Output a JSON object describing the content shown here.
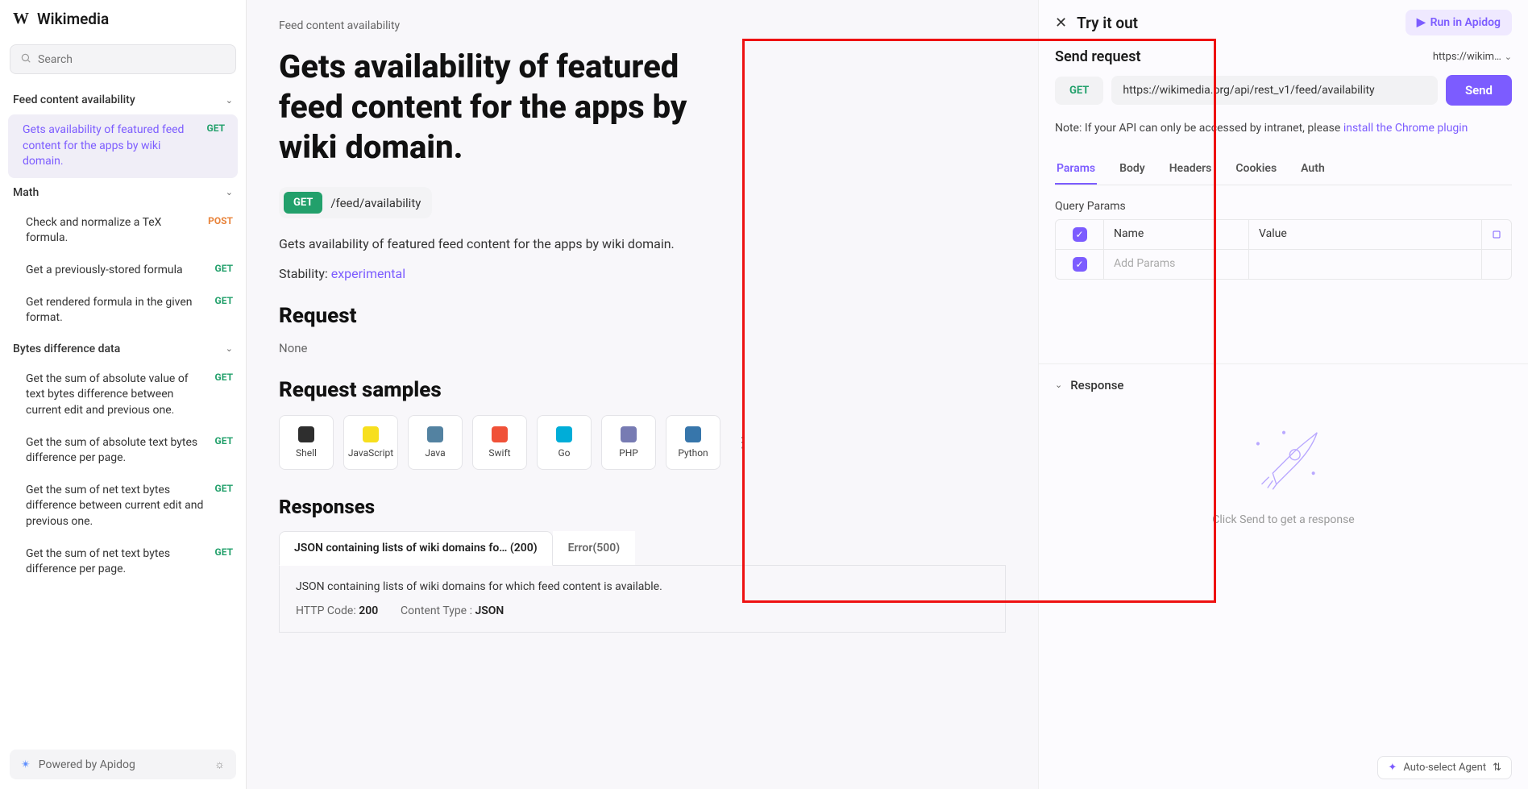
{
  "sidebar": {
    "title": "Wikimedia",
    "search_placeholder": "Search",
    "powered": "Powered by Apidog",
    "groups": [
      {
        "label": "Feed content availability",
        "items": [
          {
            "label": "Gets availability of featured feed content for the apps by wiki domain.",
            "method": "GET",
            "active": true
          }
        ]
      },
      {
        "label": "Math",
        "items": [
          {
            "label": "Check and normalize a TeX formula.",
            "method": "POST"
          },
          {
            "label": "Get a previously-stored formula",
            "method": "GET"
          },
          {
            "label": "Get rendered formula in the given format.",
            "method": "GET"
          }
        ]
      },
      {
        "label": "Bytes difference data",
        "items": [
          {
            "label": "Get the sum of absolute value of text bytes difference between current edit and previous one.",
            "method": "GET"
          },
          {
            "label": "Get the sum of absolute text bytes difference per page.",
            "method": "GET"
          },
          {
            "label": "Get the sum of net text bytes difference between current edit and previous one.",
            "method": "GET"
          },
          {
            "label": "Get the sum of net text bytes difference per page.",
            "method": "GET"
          }
        ]
      }
    ]
  },
  "main": {
    "breadcrumb": "Feed content availability",
    "title": "Gets availability of featured feed content for the apps by wiki domain.",
    "method": "GET",
    "path": "/feed/availability",
    "description": "Gets availability of featured feed content for the apps by wiki domain.",
    "stability_label": "Stability: ",
    "stability_value": "experimental",
    "section_request": "Request",
    "request_none": "None",
    "section_samples": "Request samples",
    "samples": [
      {
        "label": "Shell",
        "color": "#2e2e2e"
      },
      {
        "label": "JavaScript",
        "color": "#f7df1e"
      },
      {
        "label": "Java",
        "color": "#5382a1"
      },
      {
        "label": "Swift",
        "color": "#f05138"
      },
      {
        "label": "Go",
        "color": "#00add8"
      },
      {
        "label": "PHP",
        "color": "#777bb3"
      },
      {
        "label": "Python",
        "color": "#3776ab"
      }
    ],
    "section_responses": "Responses",
    "response_tabs": [
      {
        "label": "JSON containing lists of wiki domains fo… (200)",
        "active": true
      },
      {
        "label": "Error(500)"
      }
    ],
    "response_body_desc": "JSON containing lists of wiki domains for which feed content is available.",
    "http_code_label": "HTTP Code: ",
    "http_code_value": "200",
    "content_type_label": "Content Type : ",
    "content_type_value": "JSON"
  },
  "right": {
    "try_title": "Try it out",
    "run_label": "Run in Apidog",
    "send_request_label": "Send request",
    "url_short": "https://wikim…",
    "method": "GET",
    "url": "https://wikimedia.org/api/rest_v1/feed/availability",
    "send_button": "Send",
    "note_prefix": "Note: If your API can only be accessed by intranet, please ",
    "note_link": "install the Chrome plugin",
    "tabs": [
      "Params",
      "Body",
      "Headers",
      "Cookies",
      "Auth"
    ],
    "active_tab": "Params",
    "query_params_label": "Query Params",
    "qp_header_name": "Name",
    "qp_header_value": "Value",
    "qp_add_placeholder": "Add Params",
    "response_label": "Response",
    "response_hint": "Click Send to get a response",
    "agent_label": "Auto-select Agent"
  }
}
